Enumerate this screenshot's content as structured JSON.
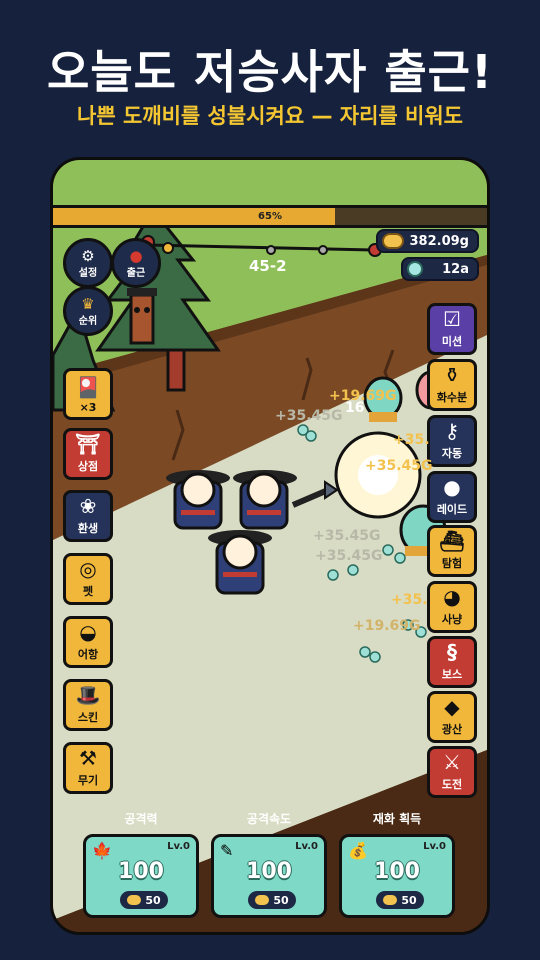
{
  "promo": {
    "title": "오늘도 저승사자 출근!",
    "subtitle": "나쁜 도깨비를 성불시켜요 — 자리를 비워도"
  },
  "hud": {
    "progress_percent": 65,
    "progress_label": "65%",
    "stage": "45-2",
    "gold": "382.09g",
    "gems": "12a",
    "settings_label": "설정",
    "attend_label": "출근",
    "rank_label": "순위"
  },
  "left_menu": [
    {
      "label": "×3",
      "icon": "cards-icon",
      "glyph": "🎴"
    },
    {
      "label": "상점",
      "icon": "shop-icon",
      "glyph": "⛩"
    },
    {
      "label": "환생",
      "icon": "lotus-icon",
      "glyph": "❀"
    },
    {
      "label": "펫",
      "icon": "pet-icon",
      "glyph": "◎"
    },
    {
      "label": "어항",
      "icon": "fishbowl-icon",
      "glyph": "◒"
    },
    {
      "label": "스킨",
      "icon": "hat-icon",
      "glyph": "🎩"
    },
    {
      "label": "무기",
      "icon": "weapon-icon",
      "glyph": "⚒"
    }
  ],
  "right_menu": [
    {
      "label": "미션",
      "icon": "checklist-icon",
      "glyph": "☑"
    },
    {
      "label": "화수분",
      "icon": "pot-icon",
      "glyph": "⚱"
    },
    {
      "label": "자동",
      "icon": "key-icon",
      "glyph": "⚷"
    },
    {
      "label": "레이드",
      "icon": "bomb-icon",
      "glyph": "●"
    },
    {
      "label": "탐험",
      "icon": "ship-icon",
      "glyph": "⛴"
    },
    {
      "label": "사냥",
      "icon": "ghost-icon",
      "glyph": "◕"
    },
    {
      "label": "보스",
      "icon": "snake-icon",
      "glyph": "§"
    },
    {
      "label": "광산",
      "icon": "crystal-icon",
      "glyph": "◆"
    },
    {
      "label": "도전",
      "icon": "sword-icon",
      "glyph": "⚔"
    }
  ],
  "damage_texts": [
    "+19.69G",
    "+35.45G",
    "+35.",
    "+35.45G",
    "+35.45G",
    "+35.",
    "+19.69G",
    "+35.45G",
    "16"
  ],
  "upgrades": [
    {
      "title": "공격력",
      "level": "Lv.0",
      "value": "100",
      "cost": "50",
      "icon": "maple-leaf-icon",
      "glyph": "🍁"
    },
    {
      "title": "공격속도",
      "level": "Lv.0",
      "value": "100",
      "cost": "50",
      "icon": "feather-icon",
      "glyph": "✎"
    },
    {
      "title": "재화 획득",
      "level": "Lv.0",
      "value": "100",
      "cost": "50",
      "icon": "money-bag-icon",
      "glyph": "💰"
    }
  ]
}
